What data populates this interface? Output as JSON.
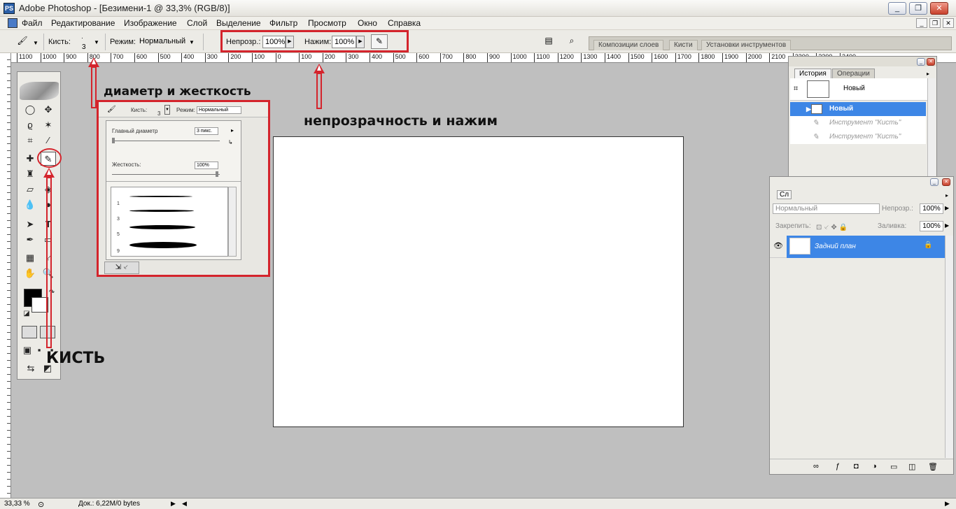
{
  "window": {
    "title": "Adobe Photoshop - [Безимени-1 @ 33,3% (RGB/8)]",
    "app_icon": "PS"
  },
  "menu": {
    "items": [
      "Файл",
      "Редактирование",
      "Изображение",
      "Слой",
      "Выделение",
      "Фильтр",
      "Просмотр",
      "Окно",
      "Справка"
    ]
  },
  "options": {
    "brush_label": "Кисть:",
    "brush_size": "3",
    "mode_label": "Режим:",
    "mode_value": "Нормальный",
    "opacity_label": "Непрозр.:",
    "opacity_value": "100%",
    "flow_label": "Нажим:",
    "flow_value": "100%"
  },
  "well_tabs": [
    "Композиции слоев",
    "Кисти",
    "Установки инструментов"
  ],
  "ruler_ticks": [
    "1100",
    "1000",
    "900",
    "800",
    "700",
    "600",
    "500",
    "400",
    "300",
    "200",
    "100",
    "0",
    "100",
    "200",
    "300",
    "400",
    "500",
    "600",
    "700",
    "800",
    "900",
    "1000",
    "1100",
    "1200",
    "1300",
    "1400",
    "1500",
    "1600",
    "1700",
    "1800",
    "1900",
    "2000",
    "2100",
    "2200",
    "2300",
    "2400"
  ],
  "annotations": {
    "diameter": "диаметр и жесткость",
    "opacity": "непрозрачность и нажим",
    "brush": "КИСТЬ"
  },
  "brush_popup": {
    "brush_label": "Кисть:",
    "brush_size": "3",
    "mode_label": "Режим:",
    "mode_value": "Нормальный",
    "diameter_label": "Главный диаметр",
    "diameter_value": "3 пикс.",
    "hardness_label": "Жесткость:",
    "hardness_value": "100%",
    "brush_numbers": [
      "1",
      "3",
      "5",
      "9"
    ]
  },
  "history": {
    "tabs": [
      "История",
      "Операции"
    ],
    "snapshot": "Новый",
    "rows": [
      {
        "label": "Новый"
      },
      {
        "label": "Инструмент \"Кисть\""
      },
      {
        "label": "Инструмент \"Кисть\""
      }
    ]
  },
  "layers": {
    "tab": "Сл",
    "blend_mode": "Нормальный",
    "opacity_label": "Непрозр.:",
    "opacity_value": "100%",
    "lock_label": "Закрепить:",
    "fill_label": "Заливка:",
    "fill_value": "100%",
    "layer_name": "Задний план"
  },
  "status": {
    "zoom": "33,33 %",
    "doc": "Док.: 6,22М/0 bytes"
  },
  "colors": {
    "annotation_red": "#d4242c",
    "selection_blue": "#3d86e6"
  }
}
